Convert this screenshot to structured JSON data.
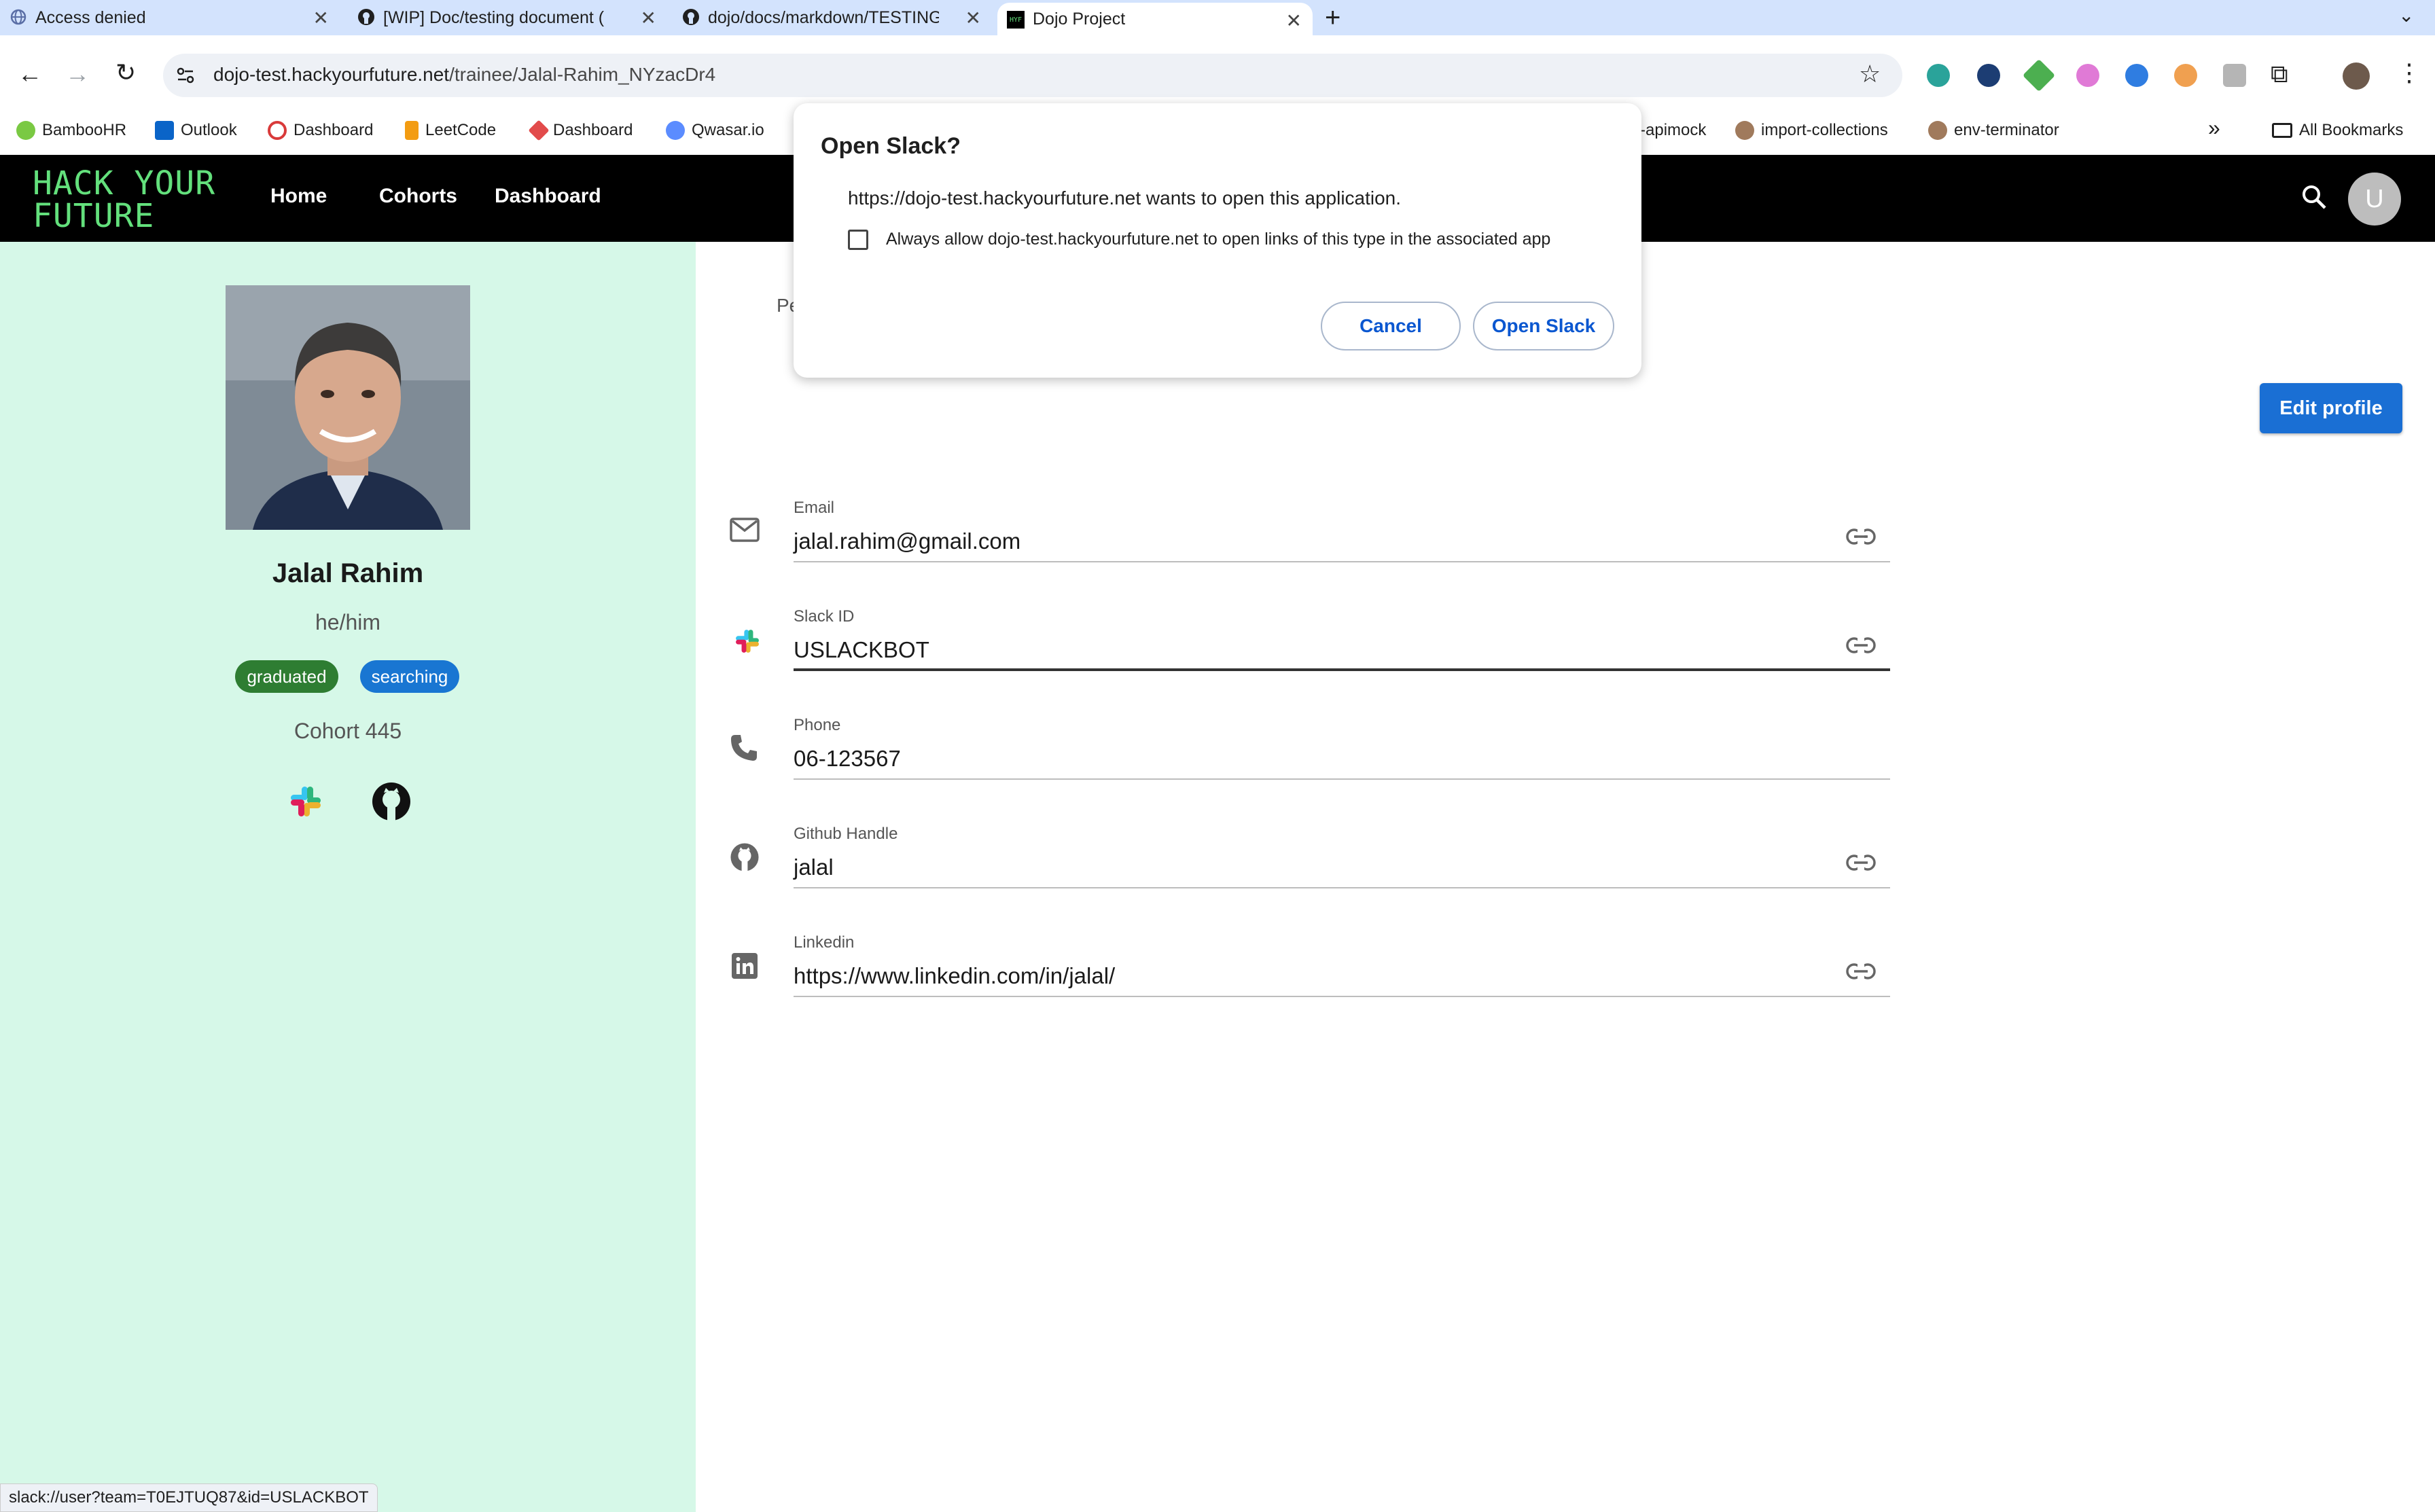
{
  "browser": {
    "tabs": [
      {
        "title": "Access denied",
        "favicon": "globe-icon"
      },
      {
        "title": "[WIP] Doc/testing document (",
        "favicon": "github-icon"
      },
      {
        "title": "dojo/docs/markdown/TESTING",
        "favicon": "github-icon"
      },
      {
        "title": "Dojo Project",
        "favicon": "hyf-icon",
        "active": true
      }
    ],
    "url_host": "dojo-test.hackyourfuture.net",
    "url_path": "/trainee/Jalal-Rahim_NYzacDr4",
    "bookmarks": [
      {
        "label": "BambooHR",
        "color": "#7ac943"
      },
      {
        "label": "Outlook",
        "color": "#0a64c8"
      },
      {
        "label": "Dashboard",
        "color": "#d93a3a"
      },
      {
        "label": "LeetCode",
        "color": "#f39c12"
      },
      {
        "label": "Dashboard",
        "color": "#e24b4b"
      },
      {
        "label": "Qwasar.io",
        "color": "#5b8cff"
      }
    ],
    "bookmarks_right": [
      {
        "label": "-apimock"
      },
      {
        "label": "import-collections"
      },
      {
        "label": "env-terminator"
      }
    ],
    "all_bookmarks": "All Bookmarks",
    "status_url": "slack://user?team=T0EJTUQ87&id=USLACKBOT"
  },
  "app": {
    "logo_line1": "HACK YOUR",
    "logo_line2": "FUTURE",
    "nav": [
      "Home",
      "Cohorts",
      "Dashboard"
    ],
    "avatar_letter": "U",
    "brand_green": "#63e07c"
  },
  "profile": {
    "name": "Jalal Rahim",
    "pronouns": "he/him",
    "tags": [
      {
        "label": "graduated",
        "color": "#2e7d32"
      },
      {
        "label": "searching",
        "color": "#1976d2"
      }
    ],
    "cohort": "Cohort 445",
    "edit_label": "Edit profile",
    "tab_partial": "Pe"
  },
  "fields": [
    {
      "label": "Email",
      "value": "jalal.rahim@gmail.com",
      "icon": "email-icon",
      "link": true
    },
    {
      "label": "Slack ID",
      "value": "USLACKBOT",
      "icon": "slack-icon",
      "link": true
    },
    {
      "label": "Phone",
      "value": "06-123567",
      "icon": "phone-icon",
      "link": false
    },
    {
      "label": "Github Handle",
      "value": "jalal",
      "icon": "github-icon",
      "link": true
    },
    {
      "label": "Linkedin",
      "value": "https://www.linkedin.com/in/jalal/",
      "icon": "linkedin-icon",
      "link": true
    }
  ],
  "dialog": {
    "title": "Open Slack?",
    "message": "https://dojo-test.hackyourfuture.net wants to open this application.",
    "checkbox_label": "Always allow dojo-test.hackyourfuture.net to open links of this type in the associated app",
    "cancel": "Cancel",
    "confirm": "Open Slack"
  }
}
